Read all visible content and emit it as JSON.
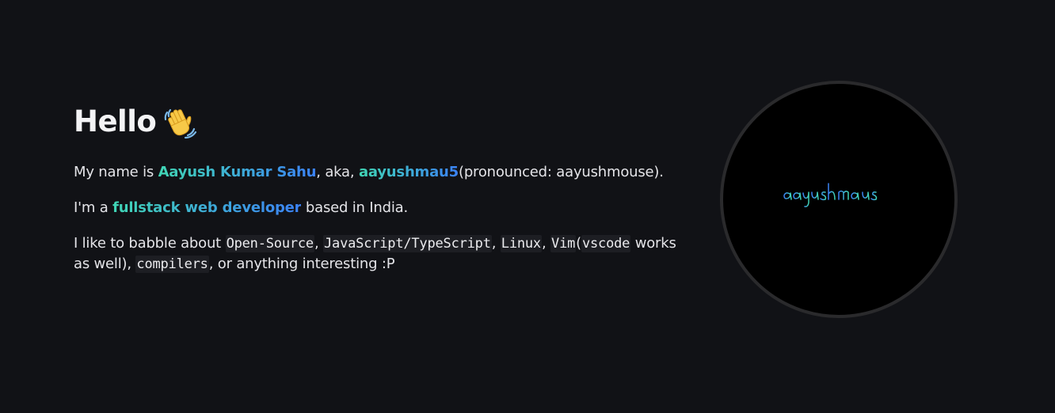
{
  "intro": {
    "title": "Hello",
    "wave_icon": "waving-hand-icon",
    "line1": {
      "prefix": "My name is ",
      "name": "Aayush Kumar Sahu",
      "middle": ", aka, ",
      "handle": "aayushmau5",
      "suffix": "(pronounced: aayushmouse)."
    },
    "line2": {
      "prefix": "I'm a ",
      "role": "fullstack web developer",
      "suffix": " based in India."
    },
    "line3": {
      "prefix": "I like to babble about ",
      "topics": [
        "Open-Source",
        "JavaScript/TypeScript",
        "Linux",
        "Vim",
        "vscode",
        "compilers"
      ],
      "sep": ", ",
      "paren_open": "(",
      "paren_close": " works as well), ",
      "suffix": ", or anything interesting :P"
    }
  },
  "avatar": {
    "signature_text": "aayushmaus"
  },
  "colors": {
    "background": "#111216",
    "accent_start": "#40d6b5",
    "accent_end": "#3b82f6",
    "avatar_ring": "#2a2a2c"
  }
}
